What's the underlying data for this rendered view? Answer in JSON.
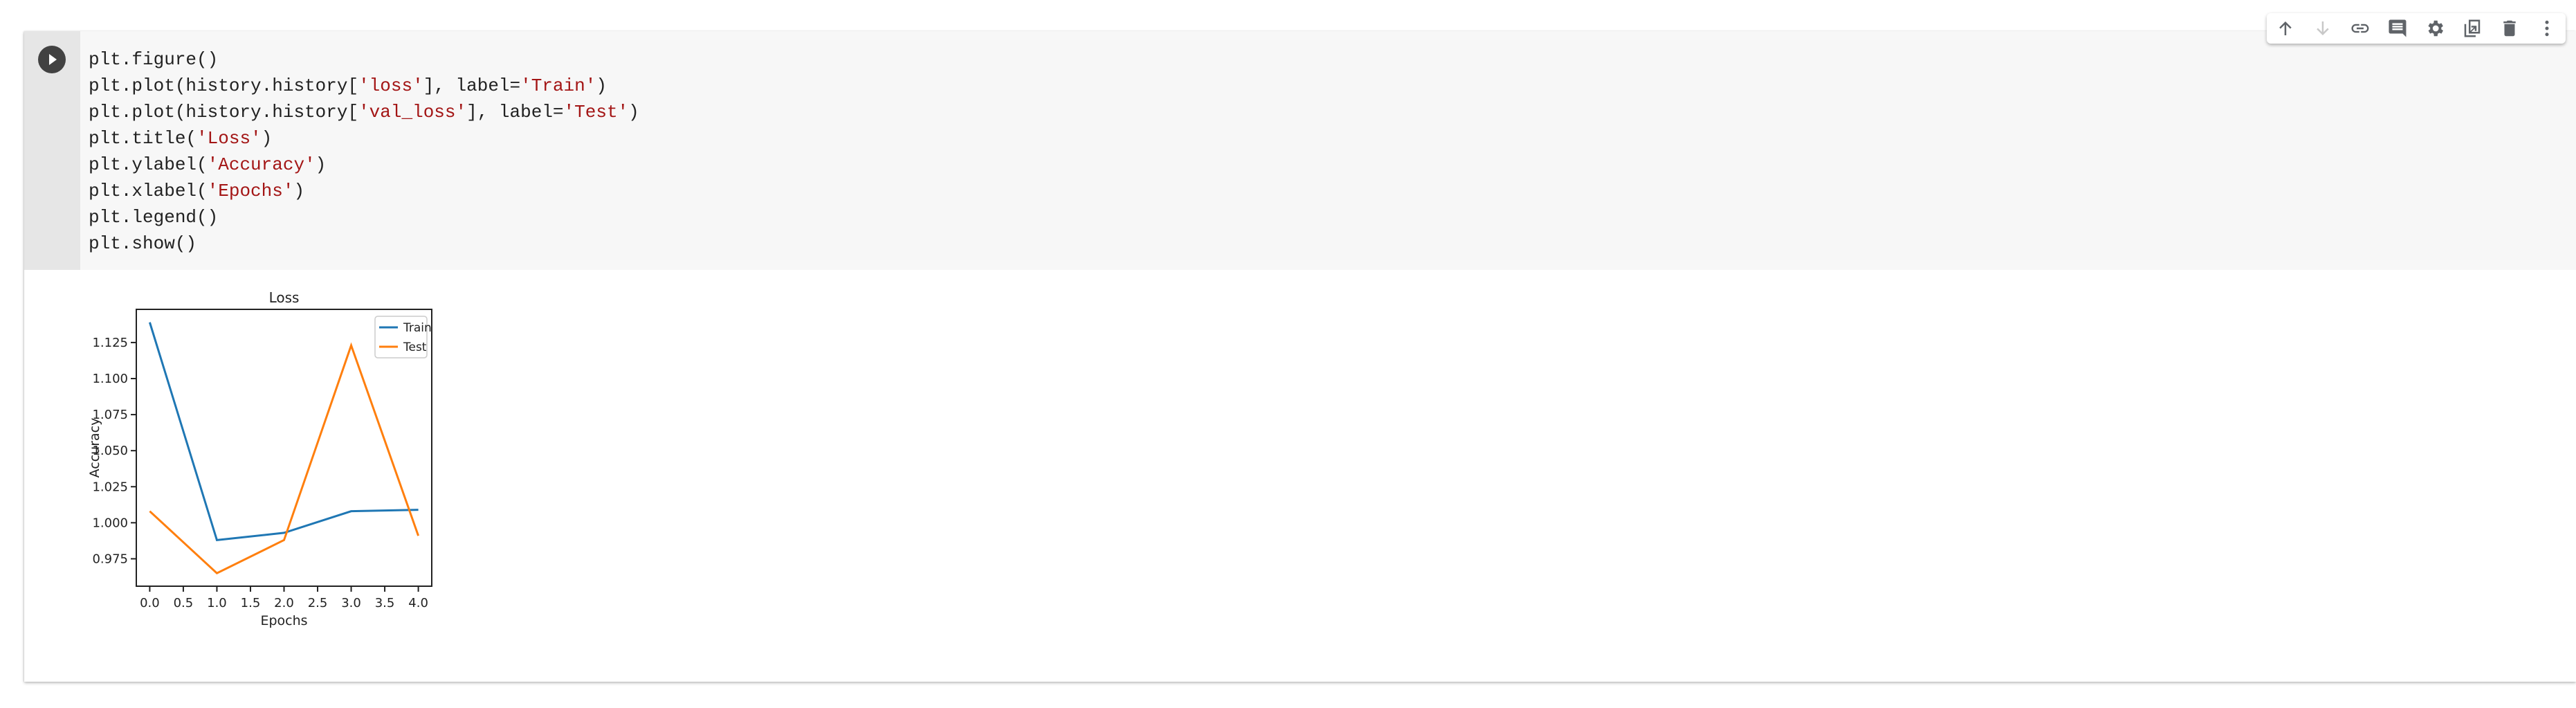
{
  "cell": {
    "code_lines": [
      [
        {
          "t": "plt.figure()",
          "s": "p"
        }
      ],
      [
        {
          "t": "plt.plot(history.history[",
          "s": "p"
        },
        {
          "t": "'loss'",
          "s": "s"
        },
        {
          "t": "], label=",
          "s": "p"
        },
        {
          "t": "'Train'",
          "s": "s"
        },
        {
          "t": ")",
          "s": "p"
        }
      ],
      [
        {
          "t": "plt.plot(history.history[",
          "s": "p"
        },
        {
          "t": "'val_loss'",
          "s": "s"
        },
        {
          "t": "], label=",
          "s": "p"
        },
        {
          "t": "'Test'",
          "s": "s"
        },
        {
          "t": ")",
          "s": "p"
        }
      ],
      [
        {
          "t": "plt.title(",
          "s": "p"
        },
        {
          "t": "'Loss'",
          "s": "s"
        },
        {
          "t": ")",
          "s": "p"
        }
      ],
      [
        {
          "t": "plt.ylabel(",
          "s": "p"
        },
        {
          "t": "'Accuracy'",
          "s": "s"
        },
        {
          "t": ")",
          "s": "p"
        }
      ],
      [
        {
          "t": "plt.xlabel(",
          "s": "p"
        },
        {
          "t": "'Epochs'",
          "s": "s"
        },
        {
          "t": ")",
          "s": "p"
        }
      ],
      [
        {
          "t": "plt.legend()",
          "s": "p"
        }
      ],
      [
        {
          "t": "plt.show()",
          "s": "p"
        }
      ]
    ]
  },
  "toolbar": {
    "icons": [
      "arrow-up-icon",
      "arrow-down-icon",
      "link-icon",
      "comment-icon",
      "gear-icon",
      "mirror-cell-icon",
      "trash-icon",
      "more-vert-icon"
    ]
  },
  "colors": {
    "train": "#1f77b4",
    "test": "#ff7f0e",
    "string": "#a31515"
  },
  "chart_data": {
    "type": "line",
    "title": "Loss",
    "xlabel": "Epochs",
    "ylabel": "Accuracy",
    "x": [
      0,
      1,
      2,
      3,
      4
    ],
    "series": [
      {
        "name": "Train",
        "values": [
          1.139,
          0.988,
          0.993,
          1.008,
          1.009
        ]
      },
      {
        "name": "Test",
        "values": [
          1.008,
          0.965,
          0.988,
          1.123,
          0.991
        ]
      }
    ],
    "xlim": [
      -0.2,
      4.2
    ],
    "ylim": [
      0.956,
      1.148
    ],
    "xticks": [
      "0.0",
      "0.5",
      "1.0",
      "1.5",
      "2.0",
      "2.5",
      "3.0",
      "3.5",
      "4.0"
    ],
    "yticks": [
      "0.975",
      "1.000",
      "1.025",
      "1.050",
      "1.075",
      "1.100",
      "1.125"
    ],
    "legend": "top-right",
    "grid": false
  }
}
